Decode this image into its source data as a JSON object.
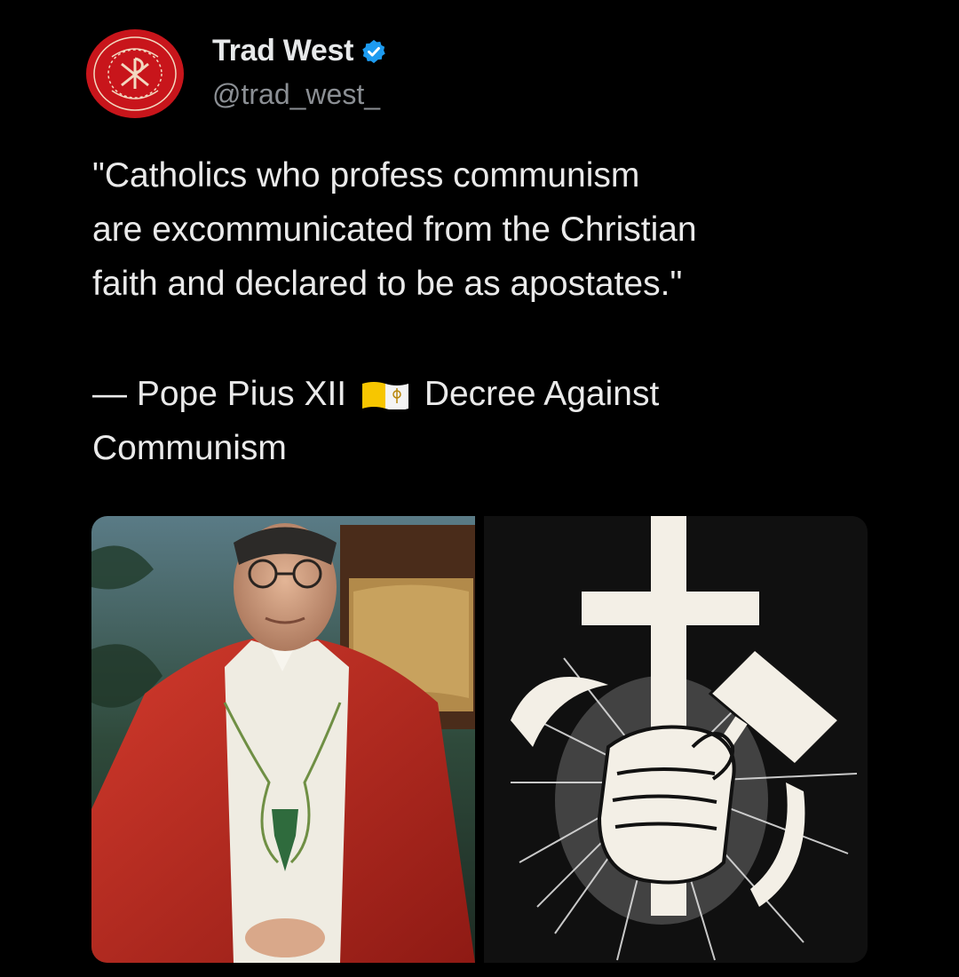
{
  "author": {
    "display_name": "Trad West",
    "handle": "@trad_west_",
    "avatar_seal_text": "TRAD WEST",
    "avatar_motto": "IN HOC SIGNO VINCES",
    "verified": true
  },
  "tweet": {
    "text": "\"Catholics who profess communism\nare excommunicated from the Christian\nfaith and declared to be as apostates.\"",
    "attribution_prefix": "— Pope Pius XII",
    "flag_icon": "vatican-flag-icon",
    "attribution_suffix": "Decree Against",
    "attribution_suffix_2": "Communism"
  },
  "media": {
    "images": [
      {
        "name": "pope-portrait-image"
      },
      {
        "name": "cross-hammer-sickle-image"
      }
    ]
  },
  "colors": {
    "background": "#000000",
    "text": "#e7e9ea",
    "handle": "#8b8f94",
    "verified": "#1d9bf0",
    "avatar_red": "#c8151b"
  }
}
